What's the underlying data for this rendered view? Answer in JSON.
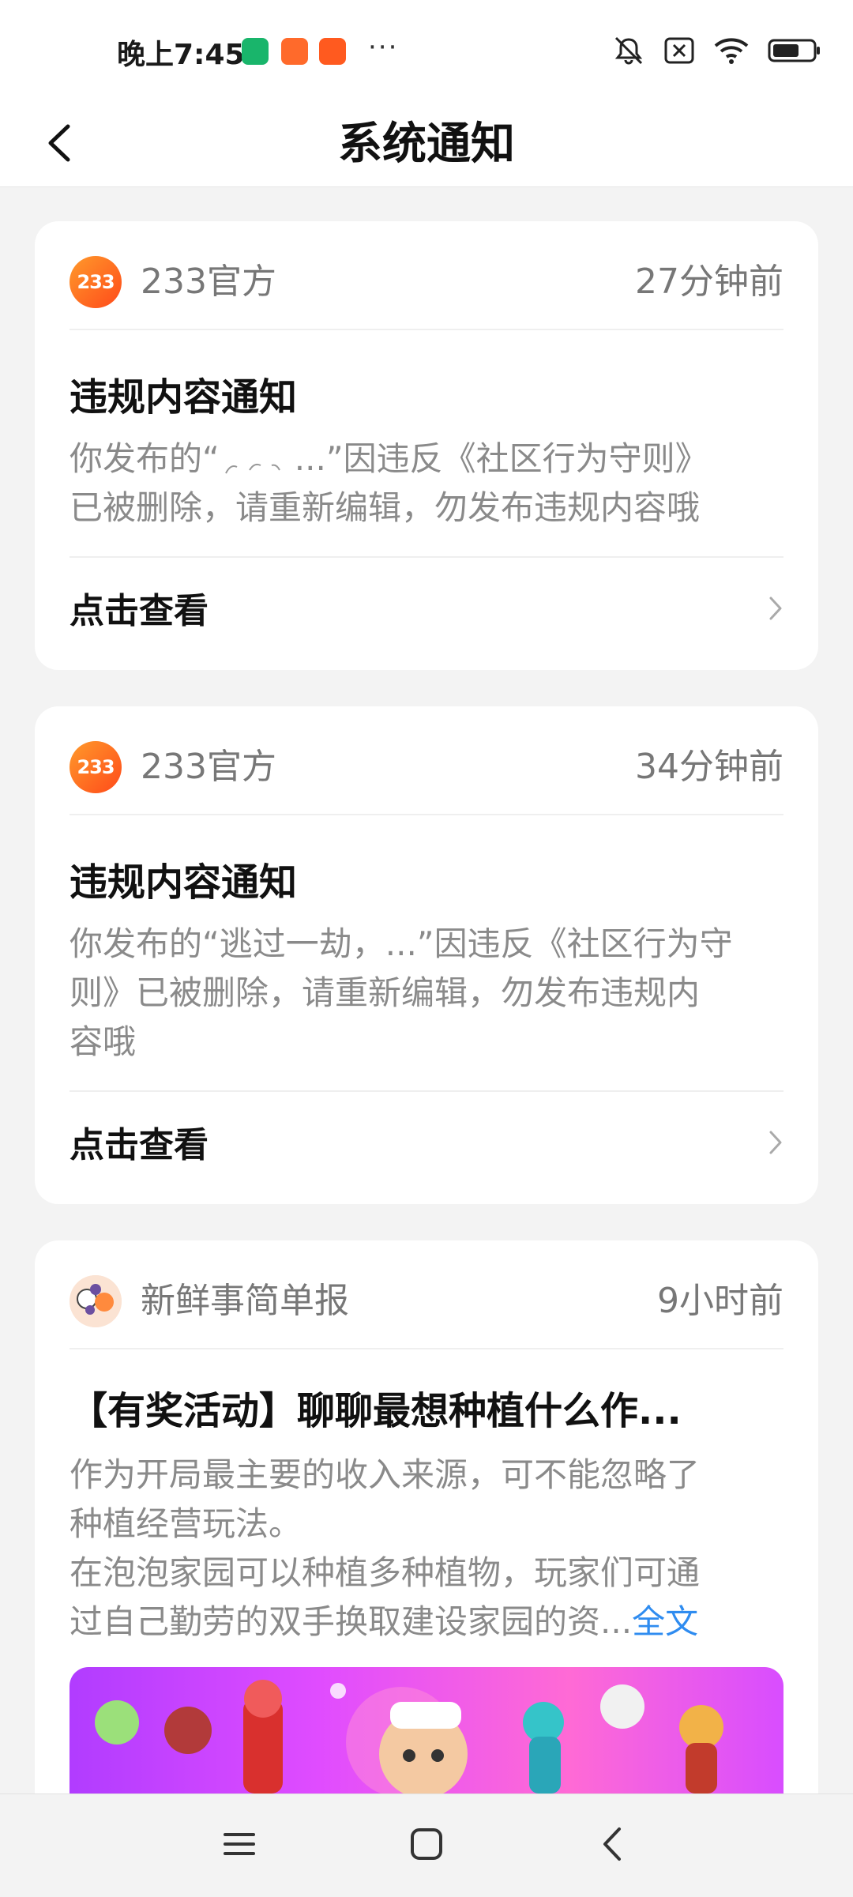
{
  "status_bar": {
    "time": "晚上7:45",
    "dots": "···",
    "icons": [
      "shield-app-icon",
      "shopping-app-icon",
      "video-app-icon",
      "mute-icon",
      "sim-off-icon",
      "wifi-icon",
      "battery-icon"
    ]
  },
  "header": {
    "title": "系统通知",
    "back_icon": "chevron-left-icon"
  },
  "notifications": [
    {
      "avatar_text": "233",
      "sender": "233官方",
      "time": "27分钟前",
      "title": "违规内容通知",
      "body_line1_prefix": "你发布的“",
      "body_line1_suffix": "...”因违反《社区行为守则》",
      "body_line2": "已被删除，请重新编辑，勿发布违规内容哦",
      "link": "点击查看"
    },
    {
      "avatar_text": "233",
      "sender": "233官方",
      "time": "34分钟前",
      "title": "违规内容通知",
      "body_line1": "你发布的“逃过一劫，...”因违反《社区行为守",
      "body_line2": "则》已被删除，请重新编辑，勿发布违规内",
      "body_line3": "容哦",
      "link": "点击查看"
    },
    {
      "sender": "新鲜事简单报",
      "time": "9小时前",
      "title": "【有奖活动】聊聊最想种植什么作...",
      "body_line1": "作为开局最主要的收入来源，可不能忽略了",
      "body_line2": "种植经营玩法。",
      "body_line3": "在泡泡家园可以种植多种植物，玩家们可通",
      "body_line4": "过自己勤劳的双手换取建设家园的资...",
      "fulltext": "全文"
    }
  ],
  "nav_bar": {
    "icons": [
      "menu-icon",
      "home-icon",
      "back-icon"
    ]
  },
  "colors": {
    "accent_link": "#2f8cf0",
    "avatar_orange": "#ff6a1a",
    "background": "#f3f3f3"
  }
}
